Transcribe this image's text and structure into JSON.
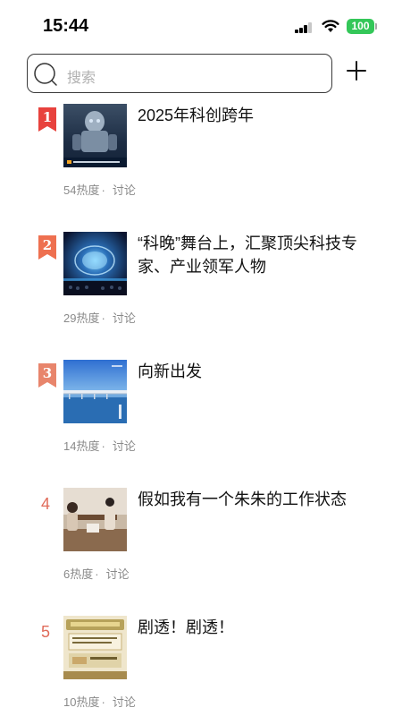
{
  "status": {
    "time": "15:44",
    "battery": "100"
  },
  "search": {
    "placeholder": "搜索"
  },
  "topics": [
    {
      "rank": "1",
      "title": "2025年科创跨年",
      "heat": "54热度",
      "separator": "·",
      "discuss": "讨论",
      "badge_color": "#e8423d"
    },
    {
      "rank": "2",
      "title": "“科晚”舞台上，汇聚顶尖科技专家、产业领军人物",
      "heat": "29热度",
      "separator": "·",
      "discuss": "讨论",
      "badge_color": "#ee7050"
    },
    {
      "rank": "3",
      "title": "向新出发",
      "heat": "14热度",
      "separator": "·",
      "discuss": "讨论",
      "badge_color": "#e8856c"
    },
    {
      "rank": "4",
      "title": "假如我有一个朱朱的工作状态",
      "heat": "6热度",
      "separator": "·",
      "discuss": "讨论"
    },
    {
      "rank": "5",
      "title": "剧透！剧透！",
      "heat": "10热度",
      "separator": "·",
      "discuss": "讨论"
    }
  ]
}
